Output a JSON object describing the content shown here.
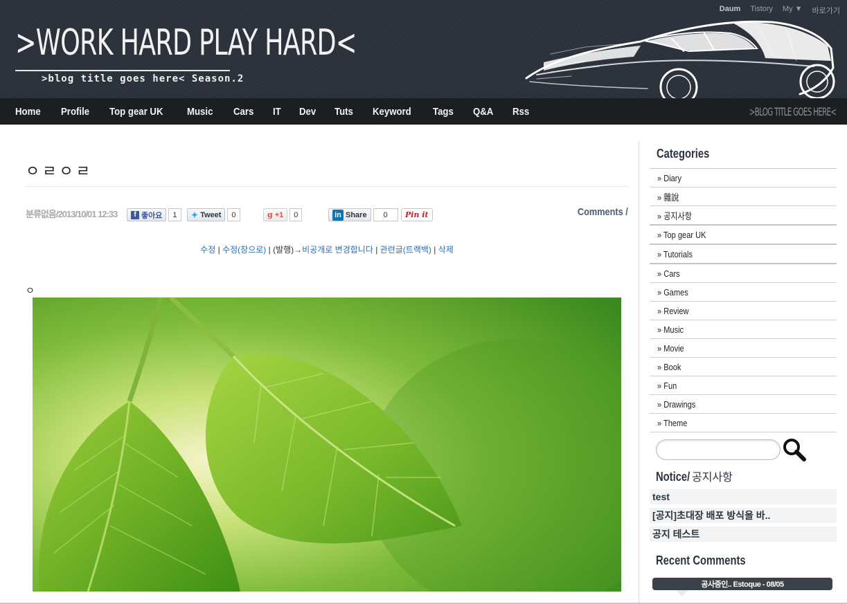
{
  "header": {
    "logo_title": ">WORK HARD PLAY HARD<",
    "logo_subtitle": ">blog title goes here< Season.2",
    "top_links": [
      "Daum",
      "Tistory",
      "My ▼",
      "바로가기"
    ]
  },
  "nav": {
    "items": [
      "Home",
      "Profile",
      "Top gear UK",
      "Music",
      "Cars",
      "IT",
      "Dev",
      "Tuts",
      "Keyword",
      "Tags",
      "Q&A",
      "Rss"
    ],
    "right_text": ">BLOG TITLE GOES HERE<"
  },
  "post": {
    "title": "ㅇㄹㅇㄹ",
    "meta": "분류없음/2013/10/01 12:33",
    "social": {
      "fb_label": "좋아요",
      "fb_count": "1",
      "tweet_label": "Tweet",
      "tweet_count": "0",
      "gplus_label": "+1",
      "gplus_count": "0",
      "share_label": "Share",
      "share_count": "0",
      "pin_label": "Pin it"
    },
    "comments_label": "Comments /",
    "admin_links": {
      "edit": "수정",
      "edit_window": "수정(창으로)",
      "published": "(발행)",
      "to_private": "비공개로 변경합니다",
      "related": "관련글(트랙백)",
      "delete": "삭제"
    },
    "content_text": "ㅇ"
  },
  "sidebar": {
    "categories_heading": "Categories",
    "categories": [
      "» Diary",
      "» 雜說",
      "» 공지사항",
      "» Top gear UK",
      "» Tutorials",
      "» Cars",
      "» Games",
      "» Review",
      "» Music",
      "» Movie",
      "» Book",
      "» Fun",
      "» Drawings",
      "» Theme"
    ],
    "search_placeholder": "",
    "notice_heading_en": "Notice/",
    "notice_heading_ko": "공지사항",
    "notices": [
      "test",
      "[공지]초대장 배포 방식을 바..",
      "공지 테스트"
    ],
    "recent_heading": "Recent Comments",
    "recent_item": "공사중인.. Estoque - 08/05"
  },
  "colors": {
    "header_bg": "#2b313a",
    "nav_bg": "#1b1e22",
    "link_blue": "#2a6fb8",
    "heading": "#2c3540"
  }
}
